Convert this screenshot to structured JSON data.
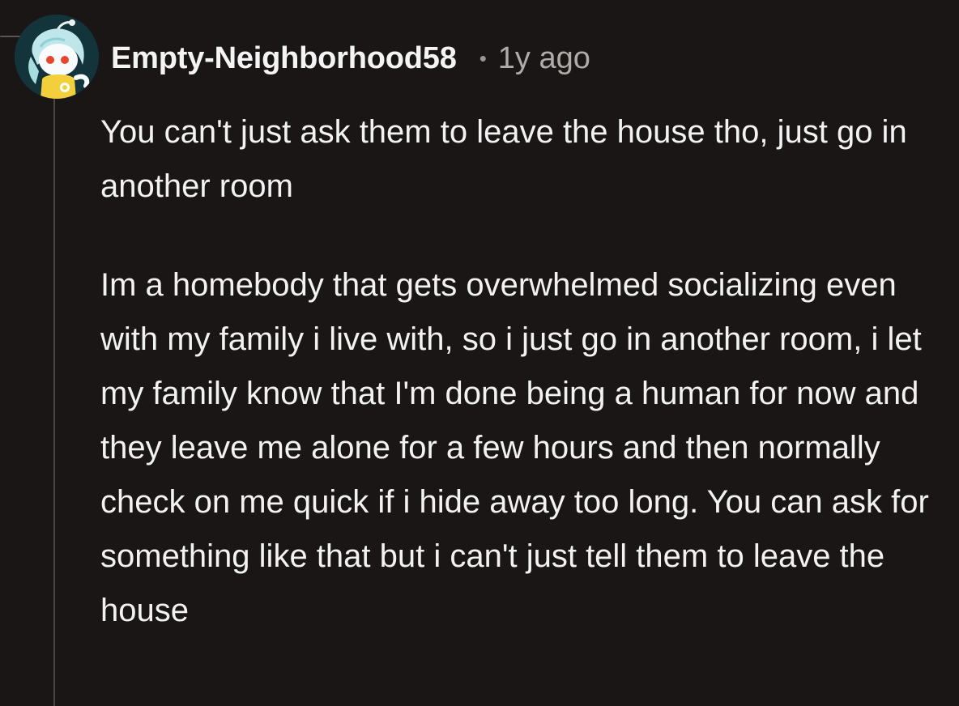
{
  "comment": {
    "author": "Empty-Neighborhood58",
    "separator": "•",
    "timestamp": "1y ago",
    "avatar_icon": "snoo-avatar-icon",
    "paragraphs": [
      "You can't just ask them to leave the house tho, just go in another room",
      "Im a homebody that gets overwhelmed socializing even with my family i live with, so i just go in another room, i let my family know that I'm done being a human for now and they leave me alone for a few hours and then normally check on me quick if i hide away too long. You can ask for something like that but i can't just tell them to leave the house"
    ]
  },
  "colors": {
    "background": "#1a1615",
    "text": "#f2f2f2",
    "meta": "#b0aaa8",
    "thread_line": "#4a4645"
  }
}
